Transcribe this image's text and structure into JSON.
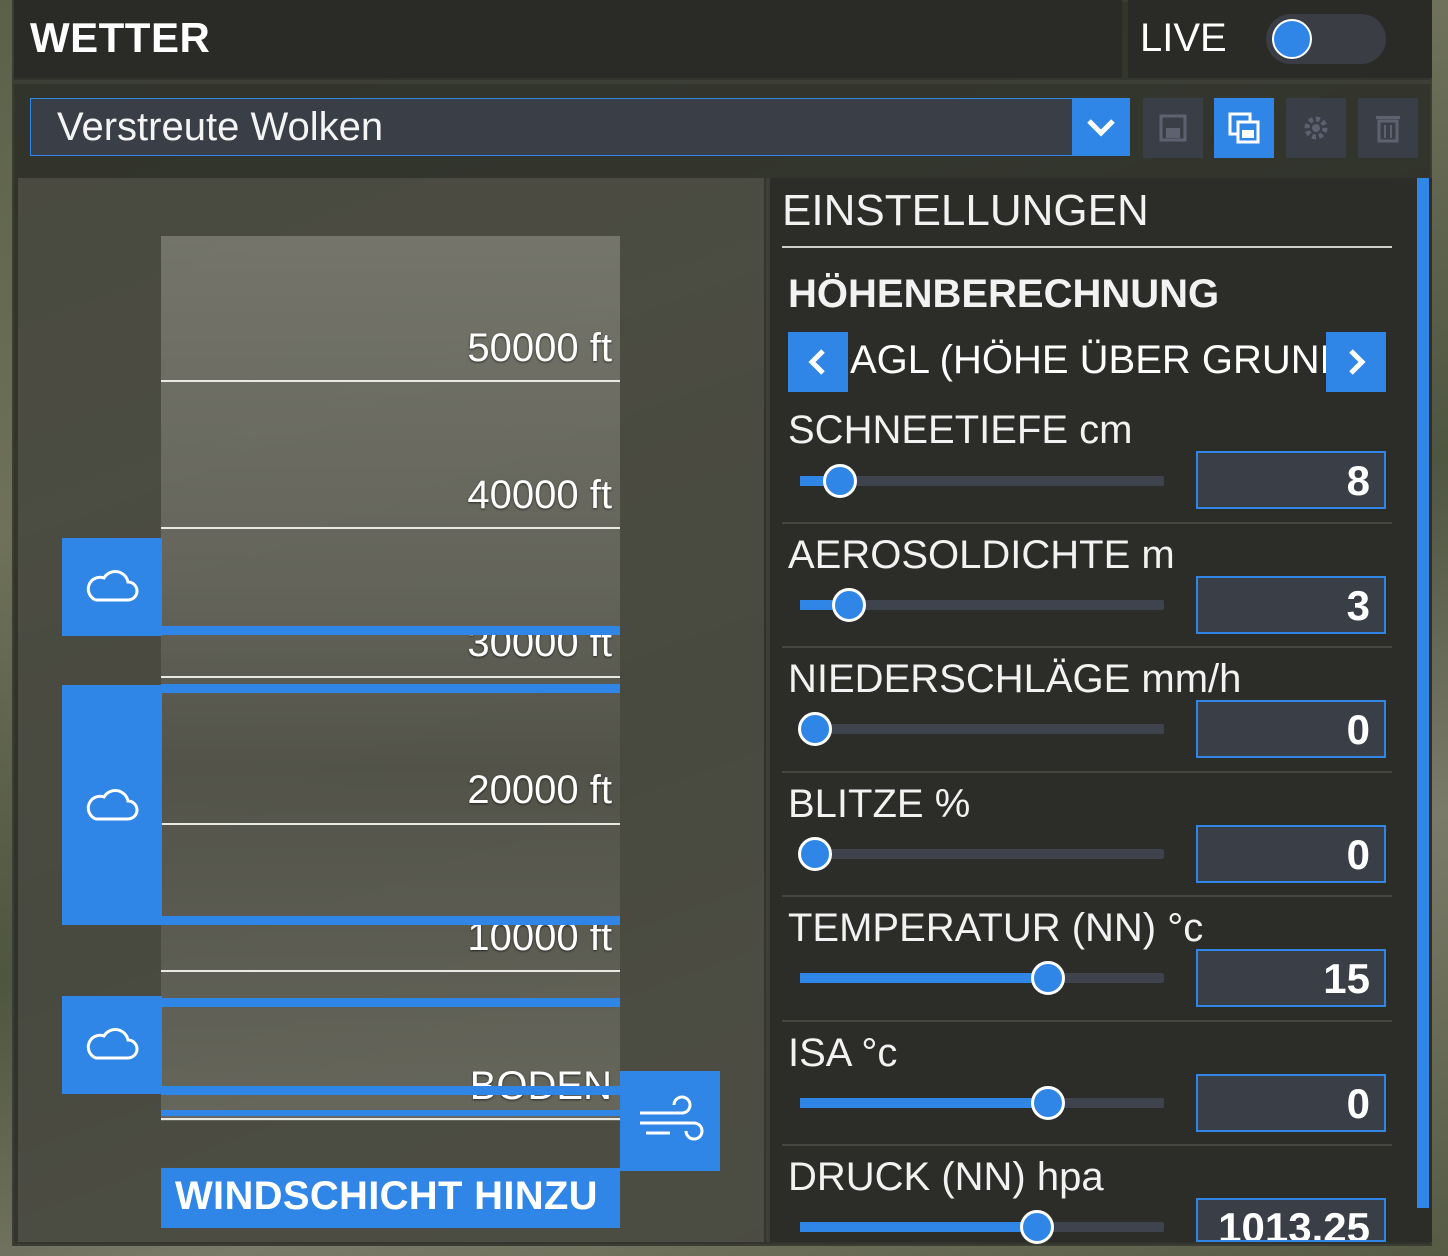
{
  "header": {
    "title": "WETTER",
    "live_label": "LIVE"
  },
  "preset": {
    "value": "Verstreute Wolken"
  },
  "toolbar": {
    "save_icon": "save-icon",
    "copy_icon": "copy-icon",
    "settings_icon": "gear-icon",
    "delete_icon": "trash-icon"
  },
  "altitude_scale": {
    "labels": [
      "50000 ft",
      "40000 ft",
      "30000 ft",
      "20000 ft",
      "10000 ft",
      "BODEN"
    ]
  },
  "cloud_layers": [
    "cloud-icon",
    "cloud-icon",
    "cloud-icon"
  ],
  "wind": {
    "add_label": "WINDSCHICHT HINZU",
    "icon": "wind-icon"
  },
  "settings": {
    "title": "EINSTELLUNGEN",
    "altitude_calc": {
      "title": "HÖHENBERECHNUNG",
      "value": "AGL (HÖHE ÜBER GRUND)"
    },
    "items": [
      {
        "label": "SCHNEETIEFE cm",
        "value": "8",
        "level_pct": 11
      },
      {
        "label": "AEROSOLDICHTE m",
        "value": "3",
        "level_pct": 13.5
      },
      {
        "label": "NIEDERSCHLÄGE mm/h",
        "value": "0",
        "level_pct": 4
      },
      {
        "label": "BLITZE %",
        "value": "0",
        "level_pct": 4
      },
      {
        "label": "TEMPERATUR (NN) °c",
        "value": "15",
        "level_pct": 68
      },
      {
        "label": "ISA °c",
        "value": "0",
        "level_pct": 68
      },
      {
        "label": "DRUCK (NN) hpa",
        "value": "1013.25",
        "level_pct": 65
      }
    ]
  },
  "colors": {
    "accent": "#2f86e6",
    "panel": "#2c2d29",
    "field": "#3a3e47"
  }
}
